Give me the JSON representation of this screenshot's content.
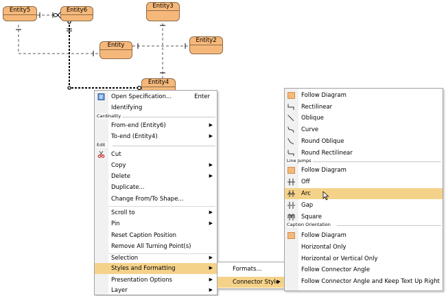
{
  "entities": {
    "entity5": "Entity5",
    "entity6": "Entity6",
    "entity3": "Entity3",
    "entity2": "Entity2",
    "entity": "Entity",
    "entity4": "Entity4"
  },
  "context_menu": {
    "open_spec": "Open Specification...",
    "open_spec_shortcut": "Enter",
    "identifying": "Identifying",
    "cardinality_group": "Cardinality",
    "from_end": "From-end (Entity6)",
    "to_end": "To-end (Entity4)",
    "edit_group": "Edit",
    "cut": "Cut",
    "copy": "Copy",
    "delete": "Delete",
    "duplicate": "Duplicate...",
    "change_shape": "Change From/To Shape...",
    "scroll_to": "Scroll to",
    "pin": "Pin",
    "reset_caption": "Reset Caption Position",
    "remove_turning": "Remove All Turning Point(s)",
    "selection": "Selection",
    "styles": "Styles and Formatting",
    "presentation": "Presentation Options",
    "layer": "Layer"
  },
  "styles_submenu": {
    "formats": "Formats...",
    "connector_style": "Connector Style"
  },
  "connector_submenu": {
    "follow_diagram_1": "Follow Diagram",
    "rectilinear": "Rectilinear",
    "oblique": "Oblique",
    "curve": "Curve",
    "round_oblique": "Round Oblique",
    "round_rectilinear": "Round Rectilinear",
    "line_jumps_group": "Line Jumps",
    "follow_diagram_2": "Follow Diagram",
    "off": "Off",
    "arc": "Arc",
    "gap": "Gap",
    "square": "Square",
    "caption_group": "Caption Orientation",
    "follow_diagram_3": "Follow Diagram",
    "horizontal_only": "Horizontal Only",
    "horiz_or_vert": "Horizontal or Vertical Only",
    "follow_angle": "Follow Connector Angle",
    "follow_angle_keep": "Follow Connector Angle and Keep Text Up Right"
  },
  "colors": {
    "entity_fill": "#f6b87a",
    "highlight": "#f5d28a"
  }
}
